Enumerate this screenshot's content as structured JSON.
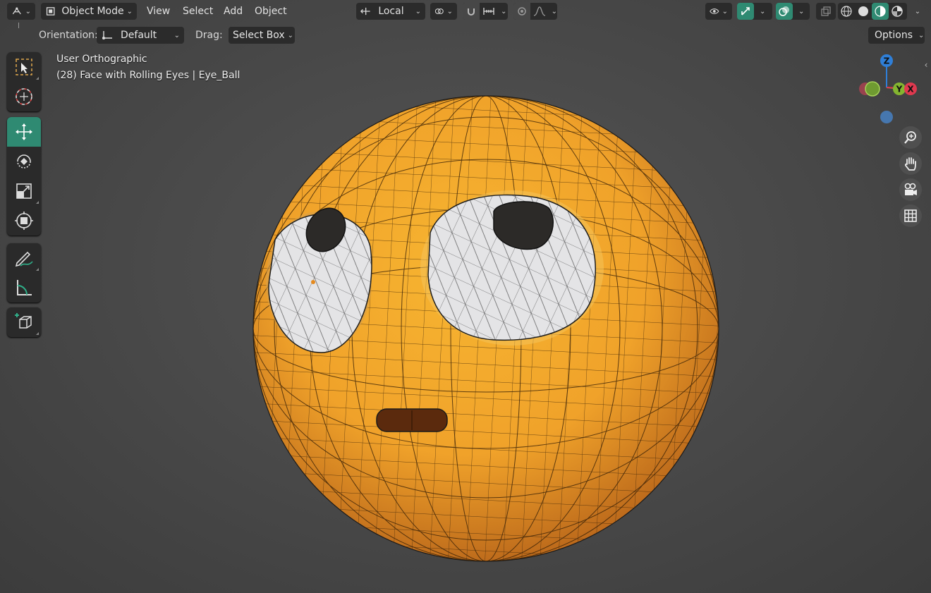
{
  "header": {
    "editor_type_icon": "axis-editor-icon",
    "mode": {
      "label": "Object Mode",
      "icon": "object-mode-icon"
    },
    "menus": [
      {
        "label": "View"
      },
      {
        "label": "Select"
      },
      {
        "label": "Add"
      },
      {
        "label": "Object"
      }
    ],
    "transform_orientation": {
      "label": "Local",
      "icon": "orientation-icon"
    },
    "pivot_icon": "pivot-point-icon",
    "snap_icon": "snap-magnet-icon",
    "snap_target_icon": "snap-increment-icon",
    "proportional_icon": "proportional-edit-icon",
    "falloff_icon": "falloff-curve-icon",
    "visibility_icon": "eye-icon",
    "gizmo_icon": "gizmo-icon",
    "overlay_icon": "overlay-icon",
    "xray_icon": "xray-icon",
    "shading": [
      {
        "icon": "wireframe-shading-icon",
        "active": false
      },
      {
        "icon": "solid-shading-icon",
        "active": false
      },
      {
        "icon": "material-shading-icon",
        "active": true
      },
      {
        "icon": "rendered-shading-icon",
        "active": false
      }
    ],
    "shading_dropdown_icon": "chevron-down-icon"
  },
  "toolsettings": {
    "orientation_label": "Orientation:",
    "orientation_value": "Default",
    "drag_label": "Drag:",
    "drag_value": "Select Box",
    "options_label": "Options"
  },
  "viewport": {
    "view_name": "User Orthographic",
    "object_info": "(28) Face with Rolling Eyes | Eye_Ball"
  },
  "toolbar": {
    "groups": [
      [
        {
          "name": "select-box",
          "icon": "select-box-icon",
          "active": false
        },
        {
          "name": "cursor",
          "icon": "cursor-icon",
          "active": false
        }
      ],
      [
        {
          "name": "move",
          "icon": "move-icon",
          "active": true
        },
        {
          "name": "rotate",
          "icon": "rotate-icon",
          "active": false
        },
        {
          "name": "scale",
          "icon": "scale-icon",
          "active": false
        },
        {
          "name": "transform",
          "icon": "transform-icon",
          "active": false
        }
      ],
      [
        {
          "name": "annotate",
          "icon": "annotate-icon",
          "active": false
        },
        {
          "name": "measure",
          "icon": "measure-icon",
          "active": false
        }
      ],
      [
        {
          "name": "add-cube",
          "icon": "add-cube-icon",
          "active": false
        }
      ]
    ]
  },
  "gizmo": {
    "axes": [
      {
        "label": "Z",
        "color": "#2f7fd8"
      },
      {
        "label": "Y",
        "color": "#84b530"
      },
      {
        "label": "X",
        "color": "#e0394f"
      }
    ]
  },
  "navigation": [
    {
      "name": "zoom",
      "icon": "zoom-icon"
    },
    {
      "name": "pan",
      "icon": "hand-icon"
    },
    {
      "name": "camera",
      "icon": "camera-icon"
    },
    {
      "name": "ortho-toggle",
      "icon": "grid-icon"
    }
  ],
  "colors": {
    "accent": "#2f8a72",
    "face": "#f0a72a",
    "face_dark": "#c9781a",
    "eye_white": "#e4e4e6",
    "pupil": "#2c2a28",
    "mouth": "#5b2a0d"
  }
}
